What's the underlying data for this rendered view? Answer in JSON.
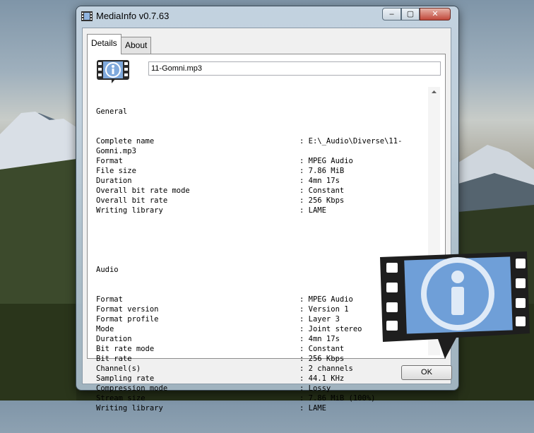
{
  "window": {
    "title": "MediaInfo v0.7.63",
    "controls": {
      "minimize": "–",
      "maximize": "▢",
      "close": "✕"
    }
  },
  "tabs": [
    {
      "label": "Details",
      "active": true
    },
    {
      "label": "About",
      "active": false
    }
  ],
  "file_field": {
    "value": "11-Gomni.mp3"
  },
  "general": {
    "heading": "General",
    "rows": [
      {
        "key": "Complete name",
        "sep": ":",
        "value": "E:\\_Audio\\Diverse\\11-"
      },
      {
        "key": "Gomni.mp3",
        "sep": "",
        "value": ""
      },
      {
        "key": "Format",
        "sep": ":",
        "value": "MPEG Audio"
      },
      {
        "key": "File size",
        "sep": ":",
        "value": "7.86 MiB"
      },
      {
        "key": "Duration",
        "sep": ":",
        "value": "4mn 17s"
      },
      {
        "key": "Overall bit rate mode",
        "sep": ":",
        "value": "Constant"
      },
      {
        "key": "Overall bit rate",
        "sep": ":",
        "value": "256 Kbps"
      },
      {
        "key": "Writing library",
        "sep": ":",
        "value": "LAME"
      }
    ]
  },
  "audio": {
    "heading": "Audio",
    "rows": [
      {
        "key": "Format",
        "sep": ":",
        "value": "MPEG Audio"
      },
      {
        "key": "Format version",
        "sep": ":",
        "value": "Version 1"
      },
      {
        "key": "Format profile",
        "sep": ":",
        "value": "Layer 3"
      },
      {
        "key": "Mode",
        "sep": ":",
        "value": "Joint stereo"
      },
      {
        "key": "Duration",
        "sep": ":",
        "value": "4mn 17s"
      },
      {
        "key": "Bit rate mode",
        "sep": ":",
        "value": "Constant"
      },
      {
        "key": "Bit rate",
        "sep": ":",
        "value": "256 Kbps"
      },
      {
        "key": "Channel(s)",
        "sep": ":",
        "value": "2 channels"
      },
      {
        "key": "Sampling rate",
        "sep": ":",
        "value": "44.1 KHz"
      },
      {
        "key": "Compression mode",
        "sep": ":",
        "value": "Lossy"
      },
      {
        "key": "Stream size",
        "sep": ":",
        "value": "7.86 MiB (100%)"
      },
      {
        "key": "Writing library",
        "sep": ":",
        "value": "LAME"
      }
    ]
  },
  "buttons": {
    "ok": "OK"
  },
  "icons": {
    "app": "mediainfo-film-icon",
    "logo": "mediainfo-info-bubble-icon",
    "overlay": "mediainfo-large-logo-icon"
  },
  "colors": {
    "logo_blue": "#6f9fd8",
    "logo_dark": "#2a2a2a"
  }
}
